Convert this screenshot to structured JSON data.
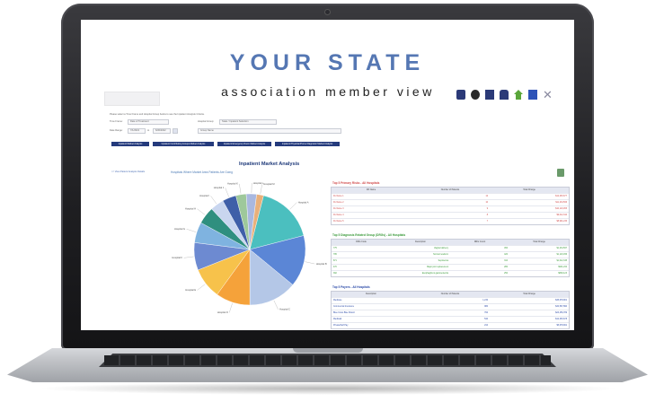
{
  "brand": {
    "headline": "YOUR STATE",
    "subheadline": "association member view"
  },
  "toolbar": {
    "icons": [
      "calendar-icon",
      "video-icon",
      "save-icon",
      "users-icon",
      "home-icon",
      "help-icon",
      "close-icon"
    ]
  },
  "filters": {
    "intro_text": "Please select a Time Frame and Hospital Group below to see the Inpatient Analysis Criteria.",
    "time_frame_label": "Time Frame:",
    "time_frame_value": "Date of Treatment",
    "hospital_group_label": "Hospital Group:",
    "hospital_group_value": "State / Inpatient Selection",
    "date_range_label": "Date Range:",
    "date_from": "7/1/2021",
    "date_to_label": "to",
    "date_to": "6/30/2022",
    "group_field": "Group Name"
  },
  "actions": [
    "Inpatient Market Analysis",
    "Inpatient Contributing Groups Market Analysis",
    "Inpatient Emergency Room Market Analysis",
    "Inpatient Physician/Home Diagnostic Market Analysis"
  ],
  "panel": {
    "title": "Inpatient Market Analysis",
    "back_link": "<< View Patient Analysis Details",
    "pie_title": "Hospitals Where Market Area Patients Are Going"
  },
  "chart_data": {
    "type": "pie",
    "title": "Hospitals Where Market Area Patients Are Going",
    "slices": [
      {
        "label": "Hospital A",
        "value": 17,
        "color": "#4bbfbf"
      },
      {
        "label": "Hospital B",
        "value": 15,
        "color": "#5b86d6"
      },
      {
        "label": "Hospital C",
        "value": 14,
        "color": "#b4c7e7"
      },
      {
        "label": "Hospital D",
        "value": 10,
        "color": "#f5a23a"
      },
      {
        "label": "Hospital E",
        "value": 9,
        "color": "#f7c24b"
      },
      {
        "label": "Hospital F",
        "value": 8,
        "color": "#6d8ad1"
      },
      {
        "label": "Hospital G",
        "value": 6,
        "color": "#7fb3e0"
      },
      {
        "label": "Hospital H",
        "value": 5,
        "color": "#2f8f7f"
      },
      {
        "label": "Hospital I",
        "value": 4,
        "color": "#c9d6ef"
      },
      {
        "label": "Hospital J",
        "value": 4,
        "color": "#3f5fa8"
      },
      {
        "label": "Hospital K",
        "value": 3,
        "color": "#9ec89b"
      },
      {
        "label": "Hospital L",
        "value": 3,
        "color": "#a9b8e0"
      },
      {
        "label": "Hospital M",
        "value": 2,
        "color": "#e9b07a"
      }
    ]
  },
  "tables": {
    "primary_risk": {
      "title": "Top 5 Primary Risks - All Hospitals",
      "title_color": "#d14b4b",
      "headers": [
        "DX Name",
        "Number of Patients",
        "Total Charge"
      ],
      "rows": [
        [
          "Dx Name 1",
          "12",
          "$12,345,677"
        ],
        [
          "Dx Name 2",
          "10",
          "$11,234,566"
        ],
        [
          "Dx Name 3",
          "9",
          "$10,123,455"
        ],
        [
          "Dx Name 4",
          "8",
          "$9,012,344"
        ],
        [
          "Dx Name 5",
          "7",
          "$8,901,233"
        ]
      ]
    },
    "drg": {
      "title": "Top 5 Diagnosis Related Group (DRGs) - All Hospitals",
      "title_color": "#3a9a3a",
      "headers": [
        "DRG Code",
        "Description",
        "DRG Count",
        "Total Charge"
      ],
      "rows": [
        [
          "775",
          "Vaginal delivery",
          "450",
          "$1,234,567"
        ],
        [
          "795",
          "Normal newborn",
          "420",
          "$1,123,456"
        ],
        [
          "871",
          "Septicemia",
          "310",
          "$1,012,345"
        ],
        [
          "470",
          "Major joint replacement",
          "280",
          "$901,234"
        ],
        [
          "392",
          "Esophagitis & gastroenteritis",
          "250",
          "$890,123"
        ]
      ]
    },
    "payers": {
      "title": "Top 5 Payers - All Hospitals",
      "title_color": "#2b4aa8",
      "headers": [
        "Description",
        "Number of Patients",
        "Total Charge"
      ],
      "rows": [
        [
          "Medicare",
          "1,234",
          "$45,678,901"
        ],
        [
          "Commercial Insurance",
          "980",
          "$34,567,890"
        ],
        [
          "Blue Cross Blue Shield",
          "760",
          "$23,456,789"
        ],
        [
          "Medicaid",
          "540",
          "$12,345,678"
        ],
        [
          "Private/Self Pay",
          "210",
          "$5,678,901"
        ]
      ]
    }
  }
}
